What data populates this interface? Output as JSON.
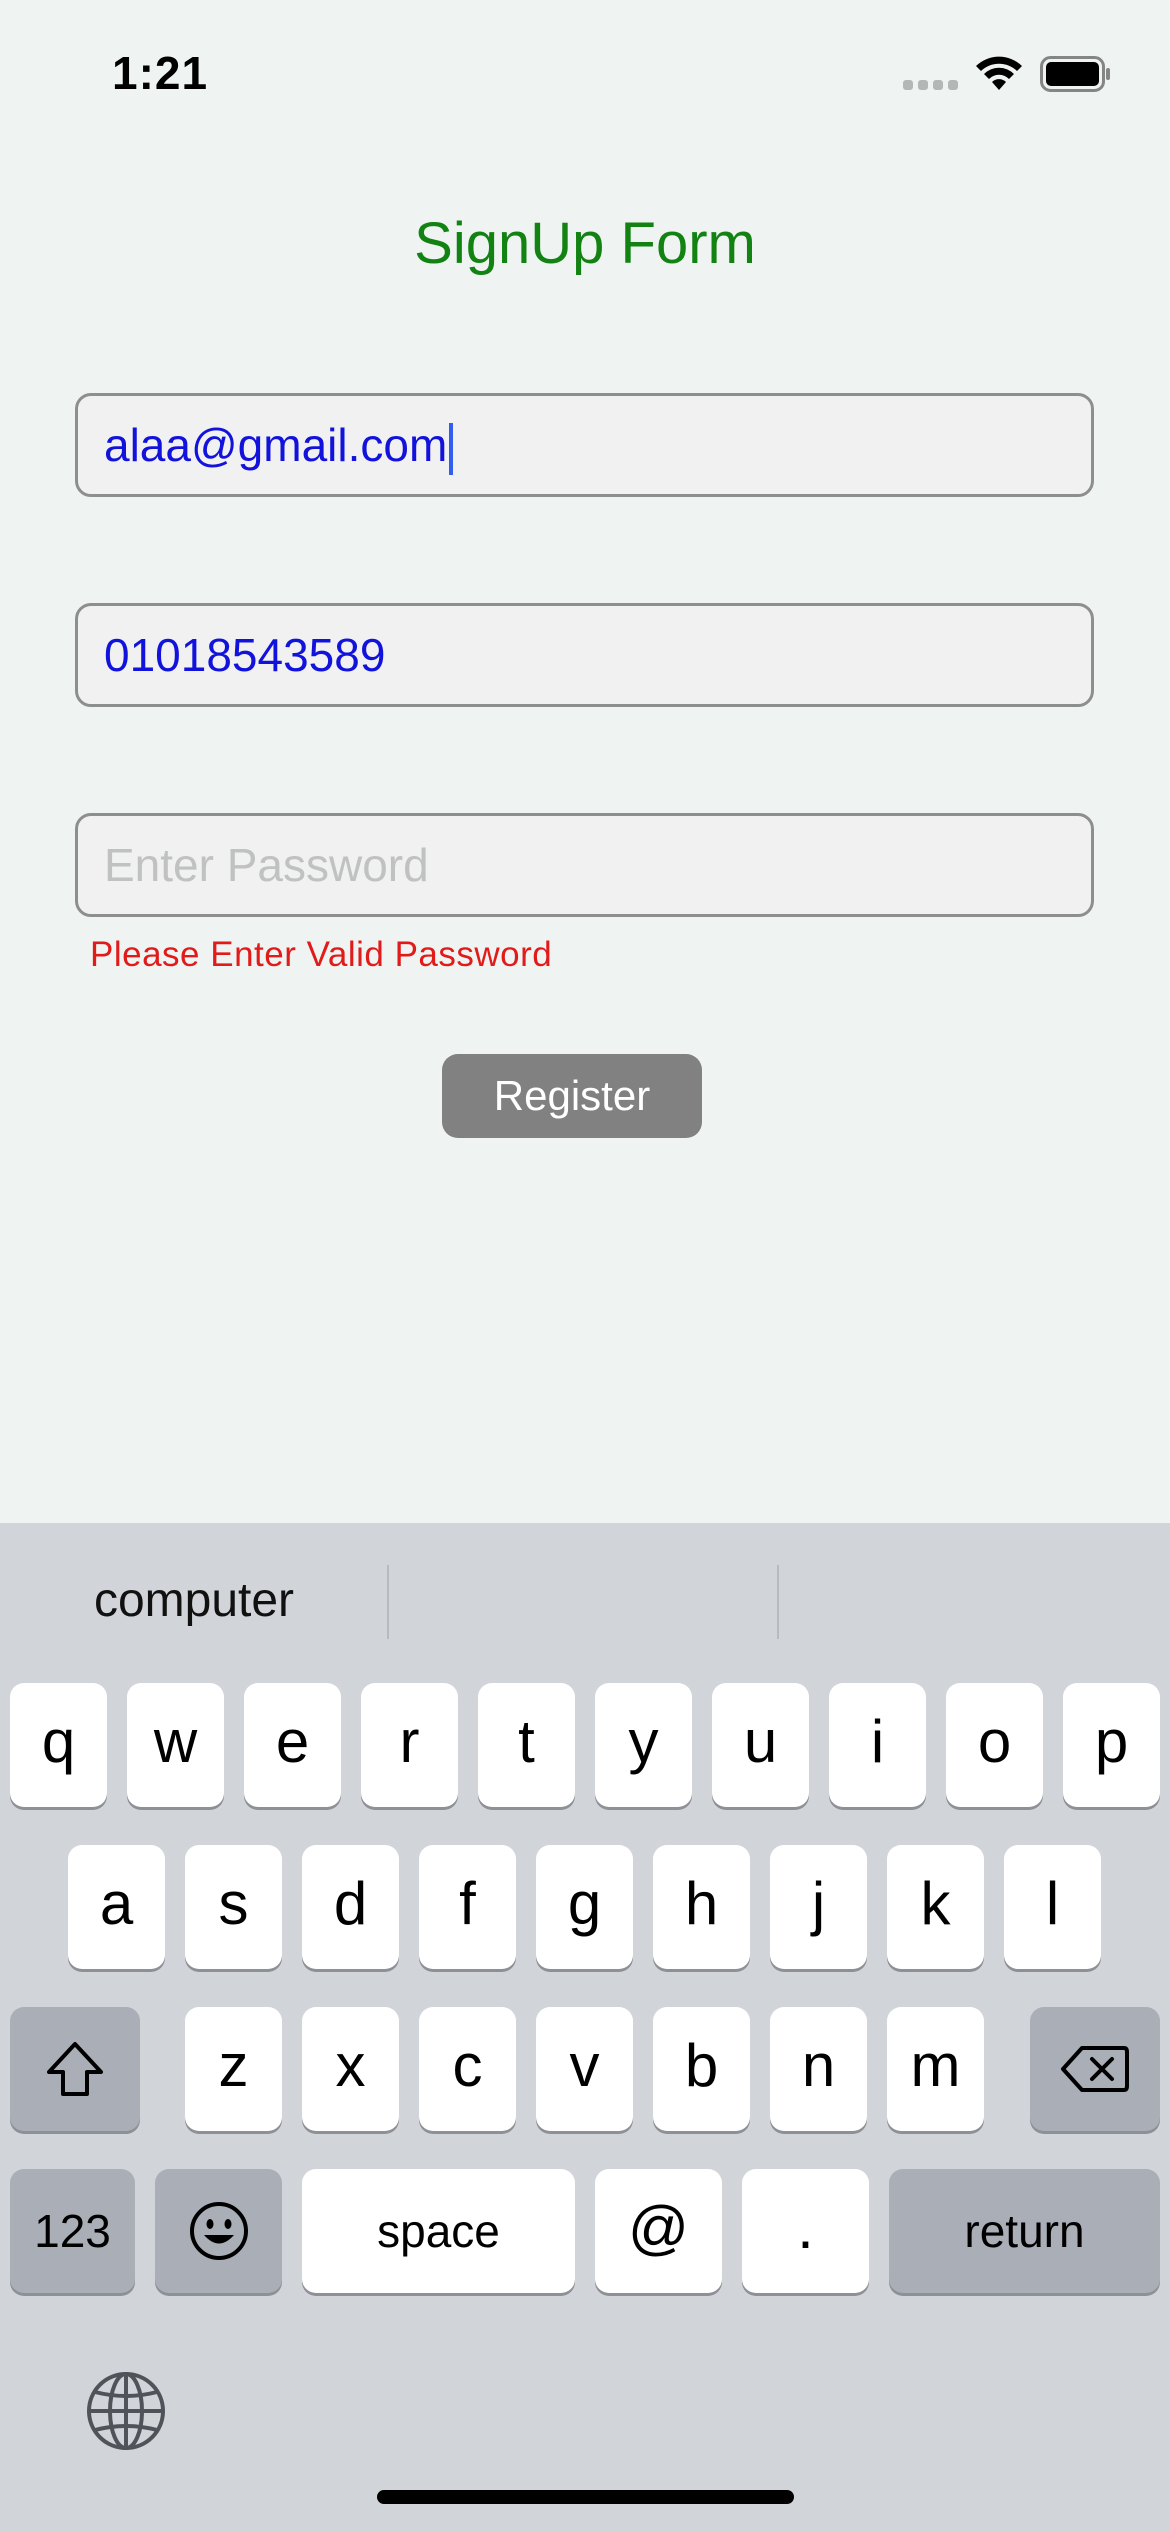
{
  "status_bar": {
    "time": "1:21",
    "icons": [
      "cellular-signal-icon",
      "wifi-icon",
      "battery-icon"
    ]
  },
  "form": {
    "title": "SignUp Form",
    "email_value": "alaa@gmail.com",
    "phone_value": "01018543589",
    "password_placeholder": "Enter Password",
    "password_error": "Please Enter Valid Password",
    "register_label": "Register"
  },
  "keyboard": {
    "suggestions": [
      "computer",
      "",
      ""
    ],
    "row1": [
      "q",
      "w",
      "e",
      "r",
      "t",
      "y",
      "u",
      "i",
      "o",
      "p"
    ],
    "row2": [
      "a",
      "s",
      "d",
      "f",
      "g",
      "h",
      "j",
      "k",
      "l"
    ],
    "row3": [
      "z",
      "x",
      "c",
      "v",
      "b",
      "n",
      "m"
    ],
    "numbers_label": "123",
    "space_label": "space",
    "at_label": "@",
    "period_label": ".",
    "return_label": "return"
  },
  "colors": {
    "title": "#128212",
    "input_text": "#1212dd",
    "error": "#e11a1a",
    "button": "#818181",
    "background": "#eff4f2"
  }
}
